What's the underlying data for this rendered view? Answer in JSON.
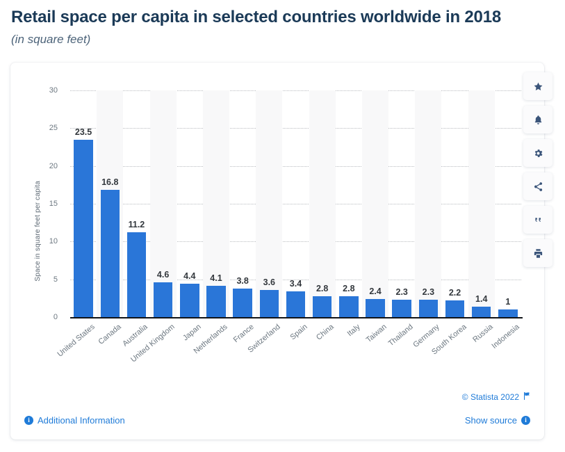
{
  "header": {
    "title": "Retail space per capita in selected countries worldwide in 2018",
    "subtitle": "(in square feet)"
  },
  "action_rail": {
    "items": [
      {
        "name": "favorite-star-icon",
        "label": "Favorite"
      },
      {
        "name": "notification-bell-icon",
        "label": "Notify"
      },
      {
        "name": "settings-gear-icon",
        "label": "Settings"
      },
      {
        "name": "share-icon",
        "label": "Share"
      },
      {
        "name": "citation-quote-icon",
        "label": "Cite"
      },
      {
        "name": "print-icon",
        "label": "Print"
      }
    ]
  },
  "footer": {
    "additional_information": "Additional Information",
    "copyright": "© Statista 2022",
    "show_source": "Show source"
  },
  "colors": {
    "bar": "#2a76d8",
    "link": "#1f7bd8",
    "title": "#1b3a57",
    "band": "#f8f8f9",
    "axis": "#111418"
  },
  "chart_data": {
    "type": "bar",
    "title": "Retail space per capita in selected countries worldwide in 2018",
    "subtitle": "(in square feet)",
    "xlabel": "",
    "ylabel": "Space in square feet per capita",
    "ylim": [
      0,
      30
    ],
    "yticks": [
      0,
      5,
      10,
      15,
      20,
      25,
      30
    ],
    "grid": true,
    "legend": false,
    "categories": [
      "United States",
      "Canada",
      "Australia",
      "United Kingdom",
      "Japan",
      "Netherlands",
      "France",
      "Switzerland",
      "Spain",
      "China",
      "Italy",
      "Taiwan",
      "Thailand",
      "Germany",
      "South Korea",
      "Russia",
      "Indonesia"
    ],
    "values": [
      23.5,
      16.8,
      11.2,
      4.6,
      4.4,
      4.1,
      3.8,
      3.6,
      3.4,
      2.8,
      2.8,
      2.4,
      2.3,
      2.3,
      2.2,
      1.4,
      1
    ],
    "value_labels": [
      "23.5",
      "16.8",
      "11.2",
      "4.6",
      "4.4",
      "4.1",
      "3.8",
      "3.6",
      "3.4",
      "2.8",
      "2.8",
      "2.4",
      "2.3",
      "2.3",
      "2.2",
      "1.4",
      "1"
    ]
  }
}
